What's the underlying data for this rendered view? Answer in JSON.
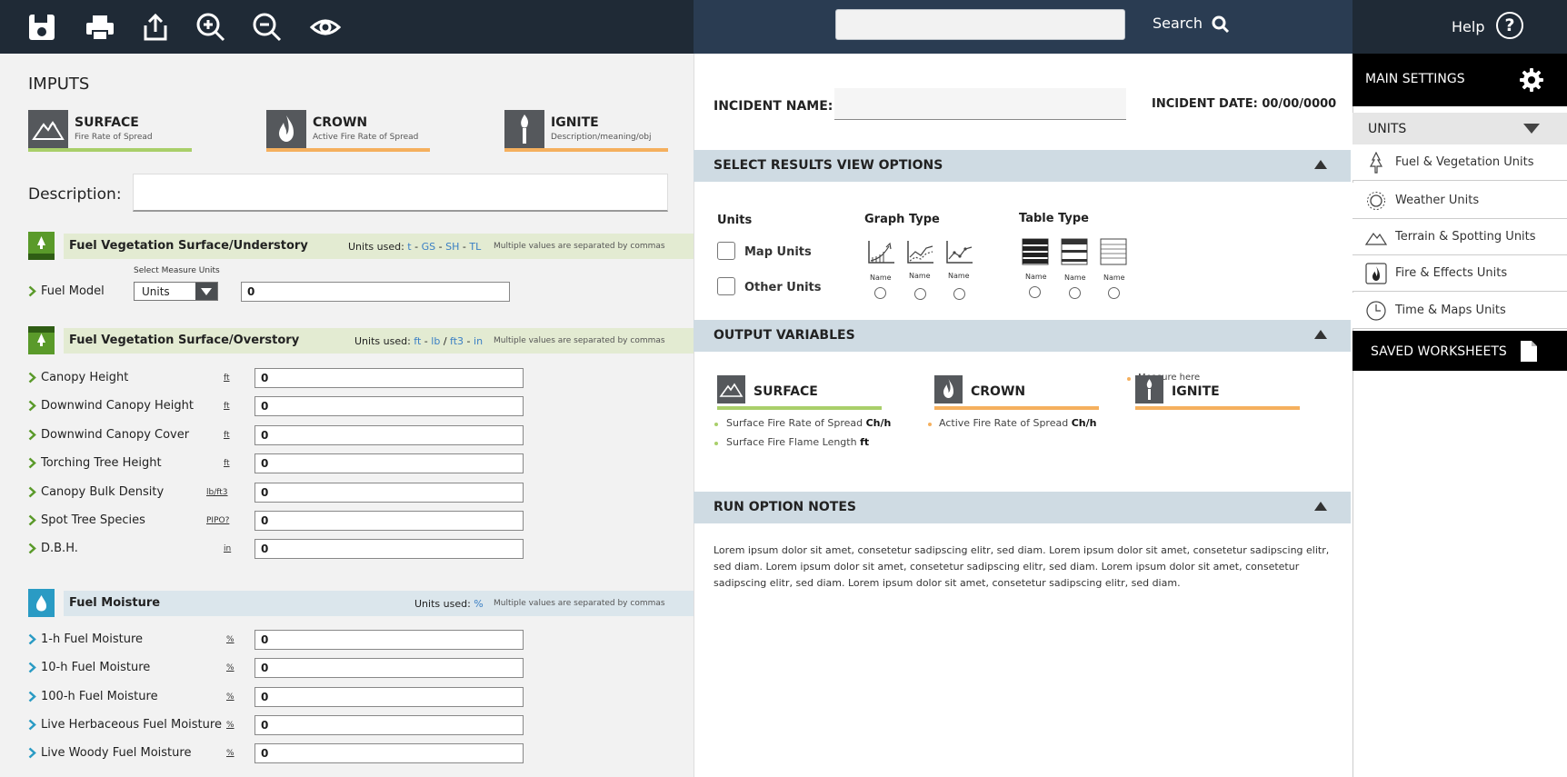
{
  "toolbar": {
    "icons": [
      "save-icon",
      "print-icon",
      "share-icon",
      "zoom-in-icon",
      "zoom-out-icon",
      "eye-icon"
    ],
    "search_label": "Search",
    "search_value": "",
    "help_label": "Help"
  },
  "inputs": {
    "title": "IMPUTS",
    "tabs": [
      {
        "title": "SURFACE",
        "subtitle": "Fire Rate of Spread",
        "color": "#a9cf6a"
      },
      {
        "title": "CROWN",
        "subtitle": "Active Fire Rate of Spread",
        "color": "#f5b05e"
      },
      {
        "title": "IGNITE",
        "subtitle": "Description/meaning/obj",
        "color": "#f5b05e"
      }
    ],
    "description_label": "Description:",
    "description_value": "",
    "understory": {
      "title": "Fuel Vegetation Surface/Understory",
      "units_prefix": "Units used:",
      "units": [
        "t",
        "GS",
        "SH",
        "TL"
      ],
      "seps": [
        "-",
        "-",
        "-"
      ],
      "note": "Multiple values are separated by commas",
      "measure_label": "Select Measure Units",
      "fuel_model_label": "Fuel Model",
      "select_value": "Units",
      "fuel_model_value": "0"
    },
    "overstory": {
      "title": "Fuel Vegetation Surface/Overstory",
      "units_prefix": "Units used:",
      "units": [
        "ft",
        "lb",
        "ft3",
        "in"
      ],
      "seps": [
        "-",
        "/",
        "-"
      ],
      "note": "Multiple values are separated by commas",
      "rows": [
        {
          "label": "Canopy Height",
          "unit": "ft",
          "value": "0"
        },
        {
          "label": "Downwind Canopy Height",
          "unit": "ft",
          "value": "0"
        },
        {
          "label": "Downwind Canopy Cover",
          "unit": "ft",
          "value": "0"
        },
        {
          "label": "Torching Tree Height",
          "unit": "ft",
          "value": "0"
        },
        {
          "label": "Canopy Bulk Density",
          "unit": "lb/ft3",
          "value": "0"
        },
        {
          "label": "Spot Tree Species",
          "unit": "PIPO?",
          "value": "0"
        },
        {
          "label": "D.B.H.",
          "unit": "in",
          "value": "0"
        }
      ]
    },
    "moisture": {
      "title": "Fuel Moisture",
      "units_prefix": "Units used:",
      "units": [
        "%"
      ],
      "note": "Multiple values are separated by commas",
      "rows": [
        {
          "label": "1-h Fuel Moisture",
          "unit": "%",
          "value": "0"
        },
        {
          "label": "10-h Fuel Moisture",
          "unit": "%",
          "value": "0"
        },
        {
          "label": "100-h Fuel Moisture",
          "unit": "%",
          "value": "0"
        },
        {
          "label": "Live Herbaceous Fuel Moisture",
          "unit": "%",
          "value": "0"
        },
        {
          "label": "Live Woody Fuel Moisture",
          "unit": "%",
          "value": "0"
        }
      ]
    }
  },
  "incident": {
    "name_label": "INCIDENT NAME:",
    "name_value": "",
    "date_label": "INCIDENT DATE: 00/00/0000"
  },
  "results_view": {
    "title": "SELECT RESULTS VIEW OPTIONS",
    "units_heading": "Units",
    "map_units": "Map Units",
    "other_units": "Other Units",
    "graph_heading": "Graph Type",
    "graph_names": [
      "Name",
      "Name",
      "Name"
    ],
    "table_heading": "Table Type",
    "table_names": [
      "Name",
      "Name",
      "Name"
    ]
  },
  "output_variables": {
    "title": "OUTPUT VARIABLES",
    "measure_here": "Measure here",
    "items": [
      {
        "title": "SURFACE",
        "color": "#a9cf6a",
        "bullets": [
          {
            "text": "Surface Fire Rate of Spread",
            "unit": "Ch/h"
          },
          {
            "text": "Surface Fire Flame Length",
            "unit": "ft"
          }
        ]
      },
      {
        "title": "CROWN",
        "color": "#f5b05e",
        "bullets": [
          {
            "text": "Active Fire Rate of Spread",
            "unit": "Ch/h"
          }
        ]
      },
      {
        "title": "IGNITE",
        "color": "#f5b05e",
        "bullets": []
      }
    ]
  },
  "run_notes": {
    "title": "RUN OPTION NOTES",
    "text": "Lorem ipsum dolor sit amet, consetetur sadipscing elitr, sed diam. Lorem ipsum dolor sit amet, consetetur sadipscing elitr, sed diam. Lorem ipsum dolor sit amet, consetetur sadipscing elitr, sed diam. Lorem ipsum dolor sit amet, consetetur sadipscing elitr, sed diam. Lorem ipsum dolor sit amet, consetetur sadipscing elitr, sed diam."
  },
  "settings": {
    "main_settings": "MAIN SETTINGS",
    "units_heading": "UNITS",
    "unit_items": [
      {
        "label": "Fuel & Vegetation Units",
        "icon": "tree-icon"
      },
      {
        "label": "Weather Units",
        "icon": "sun-icon"
      },
      {
        "label": "Terrain & Spotting Units",
        "icon": "terrain-icon"
      },
      {
        "label": "Fire & Effects Units",
        "icon": "fire-icon"
      },
      {
        "label": "Time & Maps Units",
        "icon": "clock-icon"
      }
    ],
    "saved_worksheets": "SAVED WORKSHEETS"
  },
  "colors": {
    "topbar": "#1f2a36",
    "topbar_mid": "#2a3c52",
    "surface_accent": "#a9cf6a",
    "orange_accent": "#f5b05e",
    "section_green": "#e3ebd2",
    "section_blue": "#dbe6ec",
    "moisture_blue": "#2a9bc4",
    "link_blue": "#3a7fc4"
  }
}
